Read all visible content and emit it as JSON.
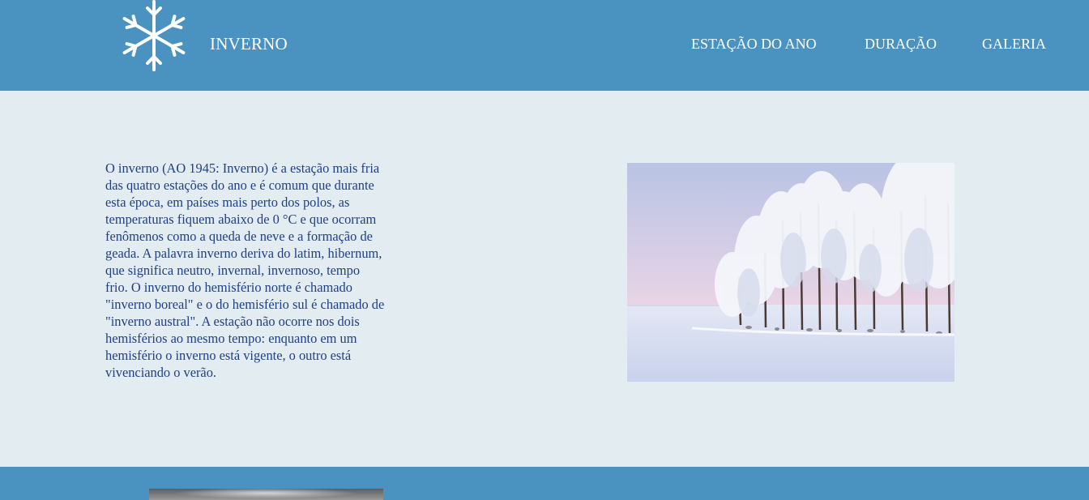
{
  "header": {
    "logo_icon": "snowflake-icon",
    "brand": "INVERNO",
    "nav": [
      {
        "label": "ESTAÇÃO DO ANO"
      },
      {
        "label": "DURAÇÃO"
      },
      {
        "label": "GALERIA"
      }
    ]
  },
  "main": {
    "intro_text": "O inverno (AO 1945: Inverno) é a estação mais fria das quatro estações do ano e é comum que durante esta época, em países mais perto dos polos, as temperaturas fiquem abaixo de 0 °C e que ocorram fenômenos como a queda de neve e a formação de geada. A palavra inverno deriva do latim, hibernum, que significa neutro, invernal, invernoso, tempo frio. O inverno do hemisfério norte é chamado \"inverno boreal\" e o do hemisfério sul é chamado de \"inverno austral\". A estação não ocorre nos dois hemisférios ao mesmo tempo: enquanto em um hemisfério o inverno está vigente, o outro está vivenciando o verão.",
    "photo_icon": "snowy-forest-image"
  },
  "colors": {
    "header_bg": "#4a92c0",
    "page_bg": "#e3ecf0",
    "text": "#1f3f86"
  }
}
